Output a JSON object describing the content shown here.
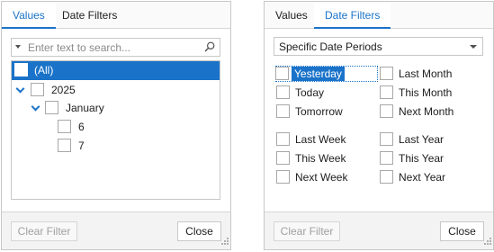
{
  "left_panel": {
    "tabs": [
      {
        "label": "Values",
        "active": true
      },
      {
        "label": "Date Filters",
        "active": false
      }
    ],
    "search": {
      "placeholder": "Enter text to search...",
      "value": ""
    },
    "tree": [
      {
        "label": "(All)",
        "level": 0,
        "expander": false,
        "selected": true,
        "checked": false
      },
      {
        "label": "2025",
        "level": 0,
        "expander": true,
        "selected": false,
        "checked": false
      },
      {
        "label": "January",
        "level": 1,
        "expander": true,
        "selected": false,
        "checked": false
      },
      {
        "label": "6",
        "level": 2,
        "expander": false,
        "selected": false,
        "checked": false
      },
      {
        "label": "7",
        "level": 2,
        "expander": false,
        "selected": false,
        "checked": false
      }
    ],
    "footer": {
      "clear_label": "Clear Filter",
      "close_label": "Close"
    }
  },
  "right_panel": {
    "tabs": [
      {
        "label": "Values",
        "active": false
      },
      {
        "label": "Date Filters",
        "active": true
      }
    ],
    "period_select": {
      "value": "Specific Date Periods"
    },
    "options_col1": [
      {
        "label": "Yesterday",
        "checked": false,
        "focused": true
      },
      {
        "label": "Today",
        "checked": false,
        "focused": false
      },
      {
        "label": "Tomorrow",
        "checked": false,
        "focused": false
      },
      {
        "label": "Last Week",
        "checked": false,
        "focused": false
      },
      {
        "label": "This Week",
        "checked": false,
        "focused": false
      },
      {
        "label": "Next Week",
        "checked": false,
        "focused": false
      }
    ],
    "options_col2": [
      {
        "label": "Last Month",
        "checked": false
      },
      {
        "label": "This Month",
        "checked": false
      },
      {
        "label": "Next Month",
        "checked": false
      },
      {
        "label": "Last Year",
        "checked": false
      },
      {
        "label": "This Year",
        "checked": false
      },
      {
        "label": "Next Year",
        "checked": false
      }
    ],
    "footer": {
      "clear_label": "Clear Filter",
      "close_label": "Close"
    }
  },
  "colors": {
    "accent": "#1a73c9",
    "border": "#c8c8c8",
    "footer_bg": "#f3f3f3"
  },
  "icons": [
    "dropdown-arrow-icon",
    "search-icon",
    "chevron-down-icon",
    "resize-grip-icon"
  ]
}
